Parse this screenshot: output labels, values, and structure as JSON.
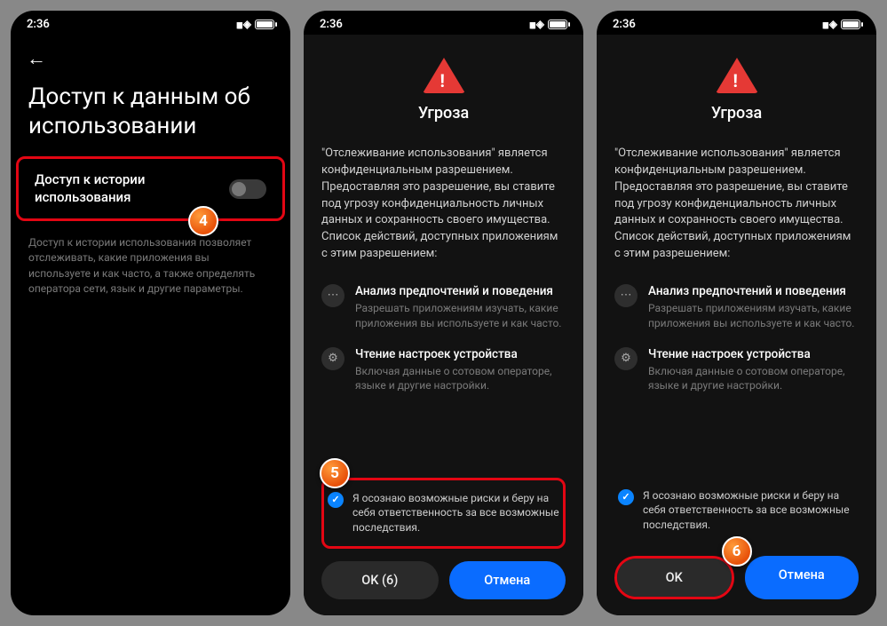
{
  "status": {
    "time": "2:36"
  },
  "screen1": {
    "title": "Доступ к данным об использовании",
    "setting_label": "Доступ к истории использования",
    "desc": "Доступ к истории использования позволяет отслеживать, какие приложения вы используете и как часто, а также определять оператора сети, язык и другие параметры."
  },
  "dialog": {
    "title": "Угроза",
    "body": "\"Отслеживание использования\" является конфиденциальным разрешением. Предоставляя это разрешение, вы ставите под угрозу конфиденциальность личных данных и сохранность своего имущества. Список действий, доступных приложениям с этим разрешением:",
    "perms": [
      {
        "title": "Анализ предпочтений и поведения",
        "desc": "Разрешать приложениям изучать, какие приложения вы используете и как часто."
      },
      {
        "title": "Чтение настроек устройства",
        "desc": "Включая данные о сотовом операторе, языке и другие настройки."
      }
    ],
    "ack": "Я осознаю возможные риски и беру на себя ответственность за все возможные последствия.",
    "ok_count": "OK (6)",
    "ok": "OK",
    "cancel": "Отмена"
  },
  "badges": {
    "b4": "4",
    "b5": "5",
    "b6": "6"
  }
}
